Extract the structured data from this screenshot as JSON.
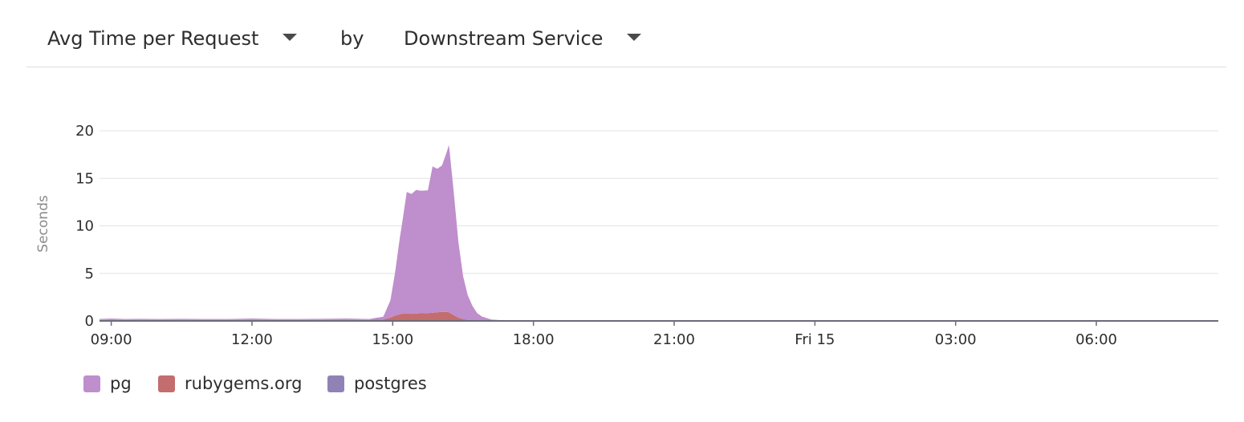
{
  "toolbar": {
    "metric_label": "Avg Time per Request",
    "metric_icon": "caret-down-icon",
    "by_label": "by",
    "group_label": "Downstream Service",
    "group_icon": "caret-down-icon"
  },
  "colors": {
    "pg": "#bf8ecc",
    "rubygems": "#c36d6f",
    "postgres": "#8f83b6",
    "grid": "#e4e4e4",
    "axis": "#6b6b7a"
  },
  "chart_data": {
    "type": "area",
    "stacked": true,
    "ylabel": "Seconds",
    "xlabel": "",
    "ylim": [
      0,
      20
    ],
    "yticks": [
      0,
      5,
      10,
      15,
      20
    ],
    "x_unit": "hours since 09:00",
    "xlim": [
      -0.25,
      23.6
    ],
    "xticks": [
      {
        "value": 0,
        "label": "09:00"
      },
      {
        "value": 3,
        "label": "12:00"
      },
      {
        "value": 6,
        "label": "15:00"
      },
      {
        "value": 9,
        "label": "18:00"
      },
      {
        "value": 12,
        "label": "21:00"
      },
      {
        "value": 15,
        "label": "Fri 15"
      },
      {
        "value": 18,
        "label": "03:00"
      },
      {
        "value": 21,
        "label": "06:00"
      }
    ],
    "grid": true,
    "legend_position": "bottom-left",
    "x": [
      -0.25,
      0.0,
      0.3,
      0.6,
      1.0,
      1.5,
      2.0,
      2.5,
      3.0,
      3.5,
      4.0,
      4.5,
      5.0,
      5.5,
      5.8,
      5.95,
      6.05,
      6.15,
      6.2,
      6.3,
      6.4,
      6.5,
      6.6,
      6.75,
      6.85,
      6.95,
      7.05,
      7.15,
      7.2,
      7.3,
      7.4,
      7.5,
      7.6,
      7.7,
      7.8,
      7.9,
      8.1,
      8.4,
      9.0,
      12.0,
      15.0,
      18.0,
      21.0,
      23.6
    ],
    "series": [
      {
        "name": "postgres",
        "values": [
          0.05,
          0.05,
          0.05,
          0.05,
          0.05,
          0.05,
          0.05,
          0.05,
          0.05,
          0.05,
          0.05,
          0.05,
          0.05,
          0.05,
          0.05,
          0.05,
          0.05,
          0.05,
          0.05,
          0.05,
          0.05,
          0.05,
          0.05,
          0.05,
          0.05,
          0.05,
          0.05,
          0.05,
          0.05,
          0.05,
          0.05,
          0.05,
          0.05,
          0.05,
          0.02,
          0.01,
          0,
          0,
          0,
          0,
          0,
          0,
          0,
          0
        ]
      },
      {
        "name": "rubygems.org",
        "values": [
          0.05,
          0.05,
          0.05,
          0.05,
          0.05,
          0.05,
          0.05,
          0.05,
          0.05,
          0.05,
          0.05,
          0.05,
          0.05,
          0.05,
          0.1,
          0.3,
          0.5,
          0.65,
          0.7,
          0.72,
          0.7,
          0.72,
          0.75,
          0.78,
          0.8,
          0.85,
          0.9,
          0.9,
          0.85,
          0.55,
          0.3,
          0.15,
          0.05,
          0.02,
          0.01,
          0,
          0,
          0,
          0,
          0,
          0,
          0,
          0,
          0
        ]
      },
      {
        "name": "pg",
        "values": [
          0.1,
          0.15,
          0.1,
          0.12,
          0.1,
          0.12,
          0.1,
          0.1,
          0.15,
          0.1,
          0.1,
          0.12,
          0.15,
          0.1,
          0.3,
          1.8,
          4.5,
          8.0,
          9.5,
          12.8,
          12.6,
          13.0,
          12.9,
          12.9,
          15.4,
          15.1,
          15.4,
          16.8,
          17.6,
          13.0,
          8.0,
          4.5,
          2.6,
          1.5,
          0.8,
          0.45,
          0.15,
          0.05,
          0,
          0,
          0,
          0,
          0,
          0
        ]
      }
    ],
    "legend": [
      "pg",
      "rubygems.org",
      "postgres"
    ]
  },
  "legend": [
    {
      "label": "pg",
      "color": "#bf8ecc"
    },
    {
      "label": "rubygems.org",
      "color": "#c36d6f"
    },
    {
      "label": "postgres",
      "color": "#8f83b6"
    }
  ]
}
